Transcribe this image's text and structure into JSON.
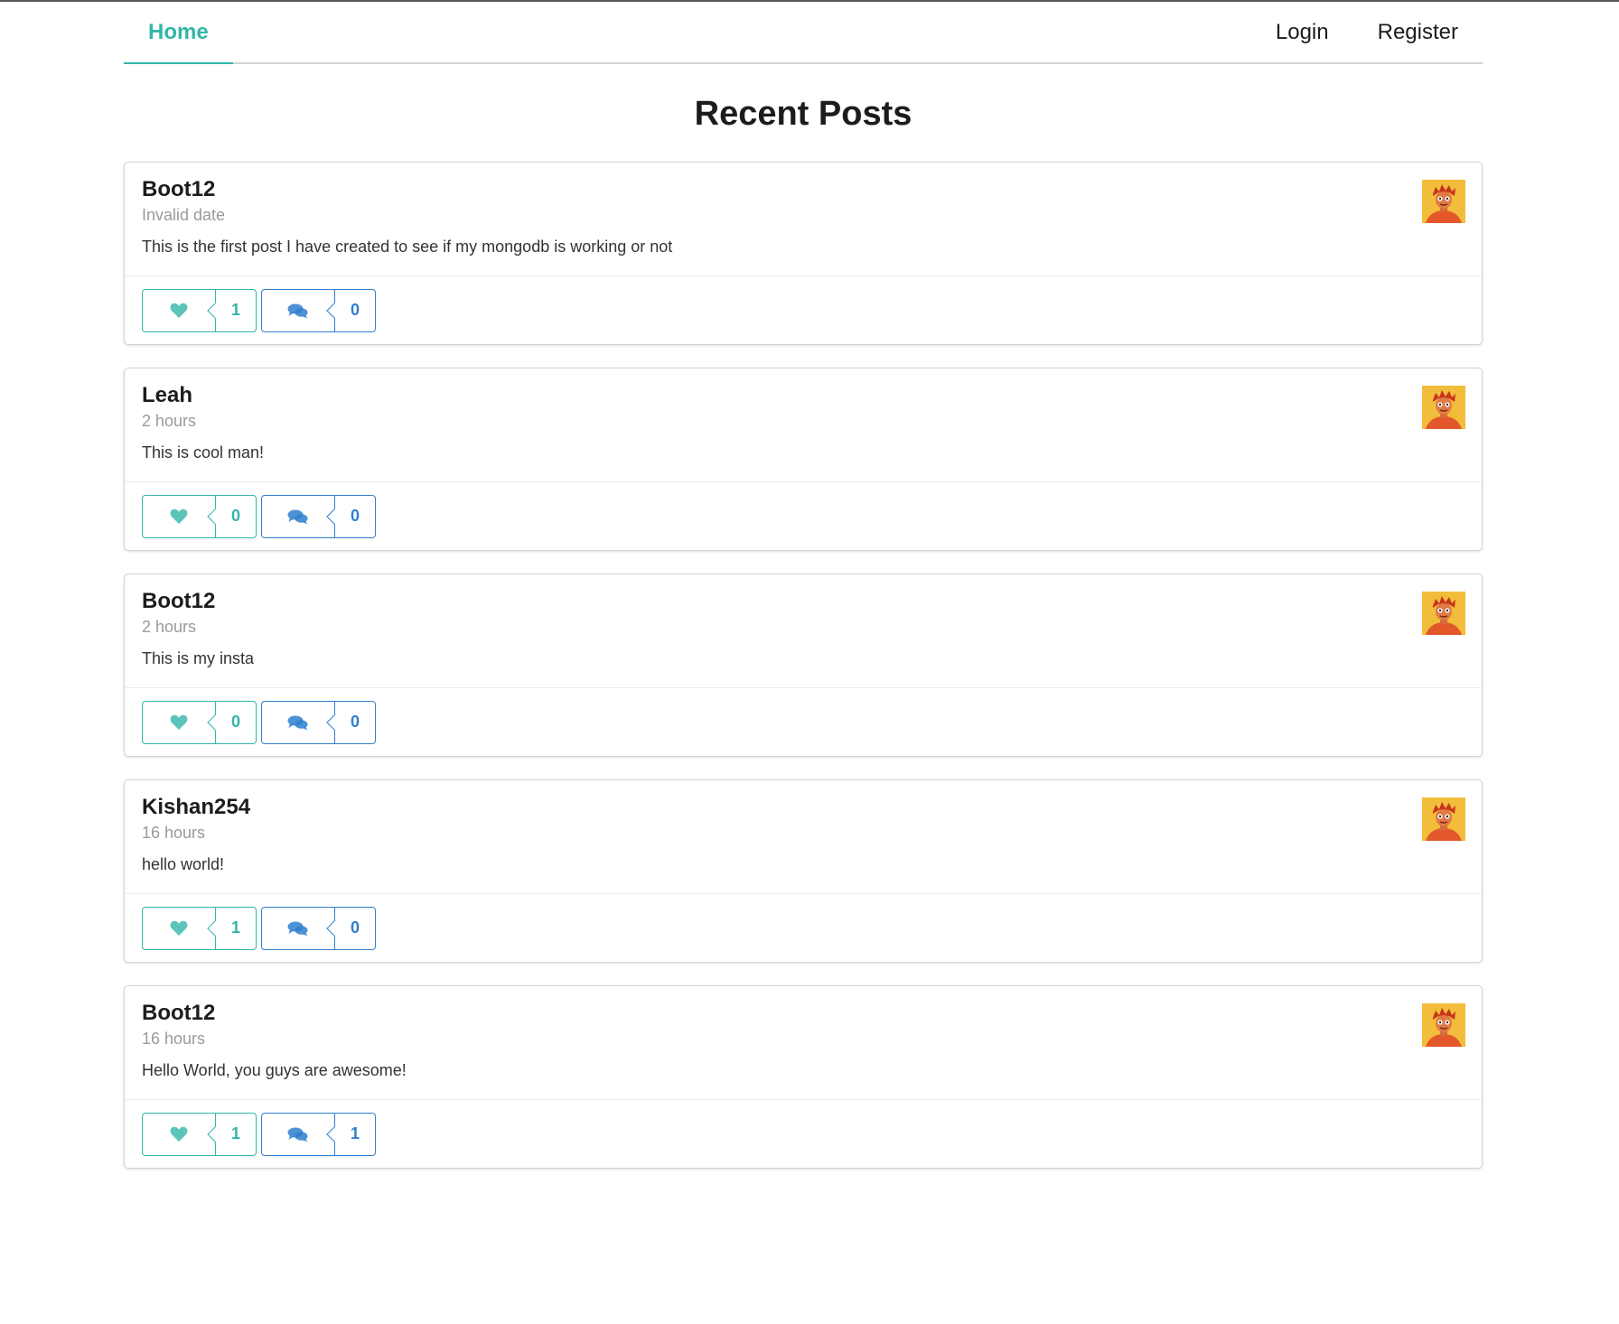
{
  "nav": {
    "home": "Home",
    "login": "Login",
    "register": "Register"
  },
  "page_title": "Recent Posts",
  "colors": {
    "accent_teal": "#33b5a8",
    "accent_blue": "#2f7fcf",
    "avatar_bg": "#f2bd3a"
  },
  "posts": [
    {
      "author": "Boot12",
      "date": "Invalid date",
      "body": "This is the first post I have created to see if my mongodb is working or not",
      "likes": "1",
      "comments": "0"
    },
    {
      "author": "Leah",
      "date": "2 hours",
      "body": "This is cool man!",
      "likes": "0",
      "comments": "0"
    },
    {
      "author": "Boot12",
      "date": "2 hours",
      "body": "This is my insta",
      "likes": "0",
      "comments": "0"
    },
    {
      "author": "Kishan254",
      "date": "16 hours",
      "body": "hello world!",
      "likes": "1",
      "comments": "0"
    },
    {
      "author": "Boot12",
      "date": "16 hours",
      "body": "Hello World, you guys are awesome!",
      "likes": "1",
      "comments": "1"
    }
  ]
}
